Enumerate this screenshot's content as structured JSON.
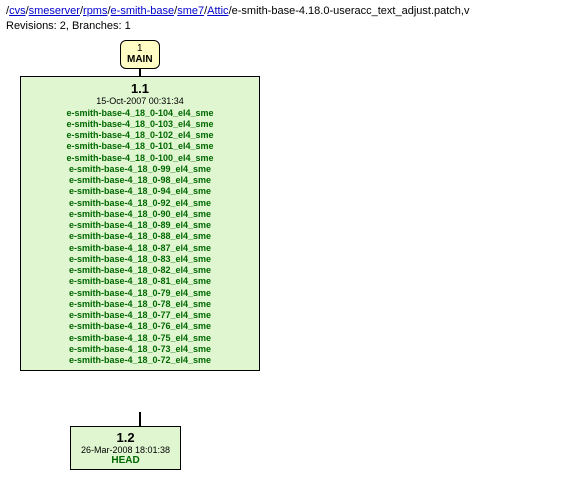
{
  "header": {
    "path_prefix": "/",
    "seg1": "cvs",
    "seg2": "smeserver",
    "seg3": "rpms",
    "seg4": "e-smith-base",
    "seg5": "sme7",
    "seg6": "Attic",
    "file": "e-smith-base-4.18.0-useracc_text_adjust.patch,v",
    "revisions_label": "Revisions: ",
    "revisions_value": "2",
    "branches_label": ", Branches: ",
    "branches_value": "1"
  },
  "branch": {
    "number": "1",
    "name": "MAIN"
  },
  "rev11": {
    "number": "1.1",
    "date": "15-Oct-2007 00:31:34",
    "tags": [
      "e-smith-base-4_18_0-104_el4_sme",
      "e-smith-base-4_18_0-103_el4_sme",
      "e-smith-base-4_18_0-102_el4_sme",
      "e-smith-base-4_18_0-101_el4_sme",
      "e-smith-base-4_18_0-100_el4_sme",
      "e-smith-base-4_18_0-99_el4_sme",
      "e-smith-base-4_18_0-98_el4_sme",
      "e-smith-base-4_18_0-94_el4_sme",
      "e-smith-base-4_18_0-92_el4_sme",
      "e-smith-base-4_18_0-90_el4_sme",
      "e-smith-base-4_18_0-89_el4_sme",
      "e-smith-base-4_18_0-88_el4_sme",
      "e-smith-base-4_18_0-87_el4_sme",
      "e-smith-base-4_18_0-83_el4_sme",
      "e-smith-base-4_18_0-82_el4_sme",
      "e-smith-base-4_18_0-81_el4_sme",
      "e-smith-base-4_18_0-79_el4_sme",
      "e-smith-base-4_18_0-78_el4_sme",
      "e-smith-base-4_18_0-77_el4_sme",
      "e-smith-base-4_18_0-76_el4_sme",
      "e-smith-base-4_18_0-75_el4_sme",
      "e-smith-base-4_18_0-73_el4_sme",
      "e-smith-base-4_18_0-72_el4_sme"
    ]
  },
  "rev12": {
    "number": "1.2",
    "date": "26-Mar-2008 18:01:38",
    "head": "HEAD"
  }
}
